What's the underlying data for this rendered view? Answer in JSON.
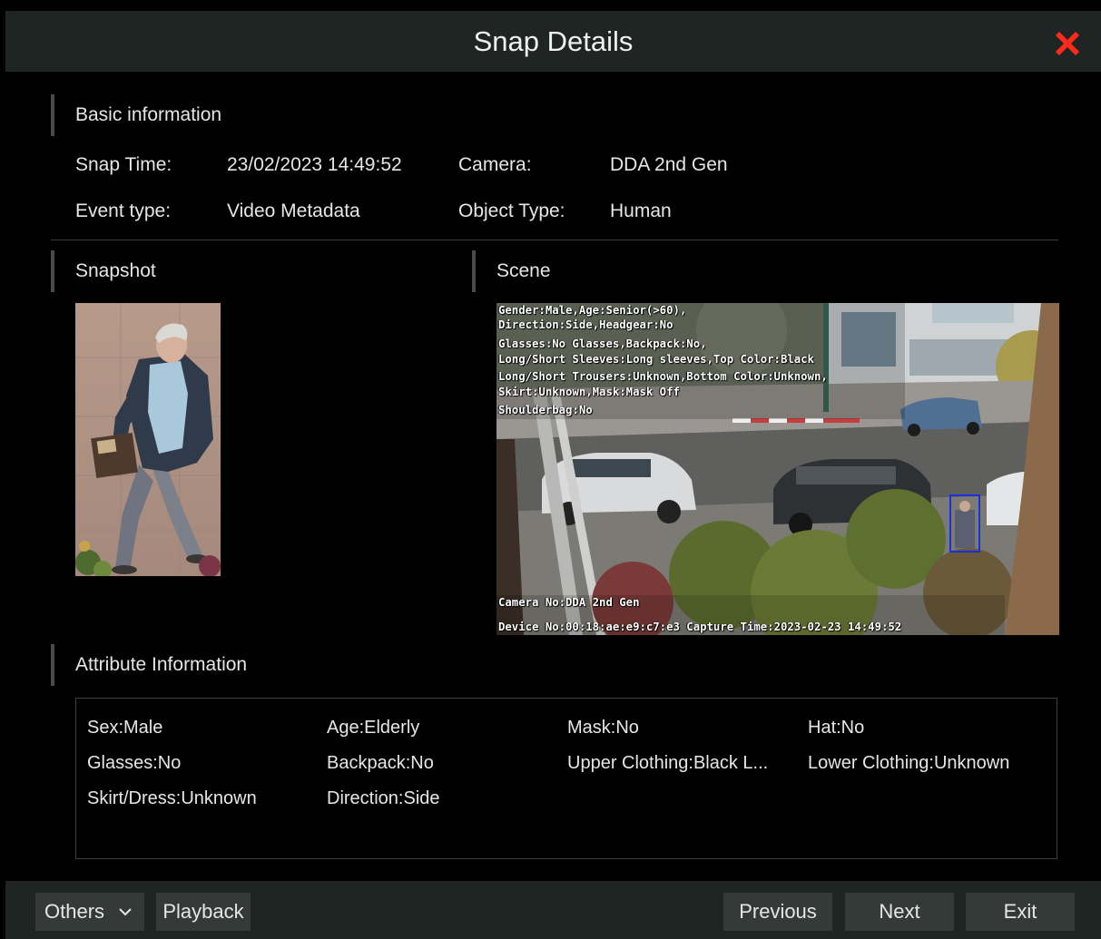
{
  "dialog": {
    "title": "Snap Details",
    "close_icon": "close-x-icon"
  },
  "basic": {
    "heading": "Basic information",
    "snap_time_label": "Snap Time:",
    "snap_time_value": "23/02/2023 14:49:52",
    "camera_label": "Camera:",
    "camera_value": "DDA 2nd Gen",
    "event_type_label": "Event type:",
    "event_type_value": "Video Metadata",
    "object_type_label": "Object Type:",
    "object_type_value": "Human"
  },
  "snapshot": {
    "heading": "Snapshot"
  },
  "scene": {
    "heading": "Scene",
    "osd_lines": [
      "Gender:Male,Age:Senior(>60),",
      "Direction:Side,Headgear:No",
      "Glasses:No Glasses,Backpack:No,",
      "Long/Short Sleeves:Long sleeves,Top Color:Black",
      "Long/Short Trousers:Unknown,Bottom Color:Unknown,",
      "Skirt:Unknown,Mask:Mask Off",
      "Shoulderbag:No"
    ],
    "camera_no": "Camera No:DDA 2nd Gen",
    "device_line": "Device No:00:18:ae:e9:c7:e3 Capture Time:2023-02-23 14:49:52",
    "detection_box_color": "#1a2fe0"
  },
  "attributes": {
    "heading": "Attribute Information",
    "items": [
      "Sex:Male",
      "Age:Elderly",
      "Mask:No",
      "Hat:No",
      "Glasses:No",
      "Backpack:No",
      "Upper Clothing:Black L...",
      "Lower Clothing:Unknown",
      "Skirt/Dress:Unknown",
      "Direction:Side"
    ]
  },
  "footer": {
    "others_label": "Others",
    "playback_label": "Playback",
    "previous_label": "Previous",
    "next_label": "Next",
    "exit_label": "Exit"
  },
  "colors": {
    "bar_background": "#1f2523",
    "button_background": "#343a38",
    "close_icon": "#ff2a1a"
  }
}
